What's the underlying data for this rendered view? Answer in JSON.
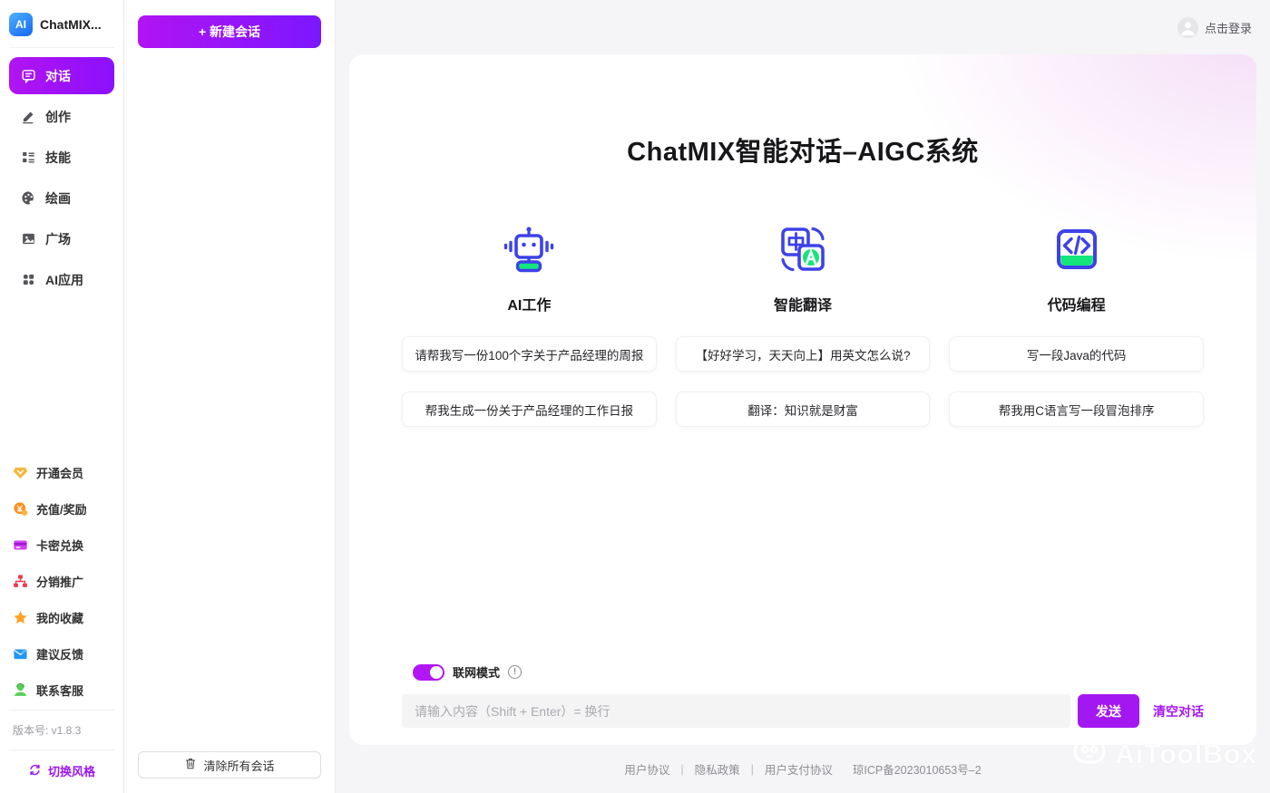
{
  "brand": {
    "logo_text": "AI",
    "app_name": "ChatMIX..."
  },
  "sidebar": {
    "nav": [
      {
        "label": "对话",
        "icon": "chat-icon",
        "active": true
      },
      {
        "label": "创作",
        "icon": "pencil-icon",
        "active": false
      },
      {
        "label": "技能",
        "icon": "skills-list-icon",
        "active": false
      },
      {
        "label": "绘画",
        "icon": "palette-icon",
        "active": false
      },
      {
        "label": "广场",
        "icon": "gallery-icon",
        "active": false
      },
      {
        "label": "AI应用",
        "icon": "apps-grid-icon",
        "active": false
      }
    ],
    "secondary": [
      {
        "label": "开通会员",
        "icon": "vip-diamond-icon"
      },
      {
        "label": "充值/奖励",
        "icon": "coin-icon"
      },
      {
        "label": "卡密兑换",
        "icon": "card-icon"
      },
      {
        "label": "分销推广",
        "icon": "affiliate-tree-icon"
      },
      {
        "label": "我的收藏",
        "icon": "star-icon"
      },
      {
        "label": "建议反馈",
        "icon": "mail-icon"
      },
      {
        "label": "联系客服",
        "icon": "support-agent-icon"
      }
    ],
    "version": "版本号: v1.8.3",
    "style_switch": "切换风格"
  },
  "conversations": {
    "new_button": "+ 新建会话",
    "clear_all": "清除所有会话"
  },
  "header": {
    "login": "点击登录"
  },
  "main": {
    "title": "ChatMIX智能对话–AIGC系统",
    "features": [
      {
        "label": "AI工作",
        "icon": "robot-icon",
        "suggestions": [
          "请帮我写一份100个字关于产品经理的周报",
          "帮我生成一份关于产品经理的工作日报"
        ]
      },
      {
        "label": "智能翻译",
        "icon": "translate-icon",
        "suggestions": [
          "【好好学习，天天向上】用英文怎么说?",
          "翻译：知识就是财富"
        ]
      },
      {
        "label": "代码编程",
        "icon": "code-icon",
        "suggestions": [
          "写一段Java的代码",
          "帮我用C语言写一段冒泡排序"
        ]
      }
    ],
    "network_mode": {
      "label": "联网模式",
      "enabled": true
    },
    "input": {
      "value": "",
      "placeholder": "请输入内容（Shift + Enter）= 换行"
    },
    "send_button": "发送",
    "clear_chat": "清空对话"
  },
  "footer": {
    "links": [
      "用户协议",
      "隐私政策",
      "用户支付协议"
    ],
    "separator": "|",
    "icp": "琼ICP备2023010653号–2"
  },
  "watermark": "AiToolBox",
  "colors": {
    "accent": "#a318f0",
    "nav_gradient_start": "#b114f2",
    "nav_gradient_end": "#8b10fd",
    "feature_icon_blue": "#3d42e8",
    "feature_icon_green": "#14e57a",
    "logo_blue": "#1565f0"
  }
}
